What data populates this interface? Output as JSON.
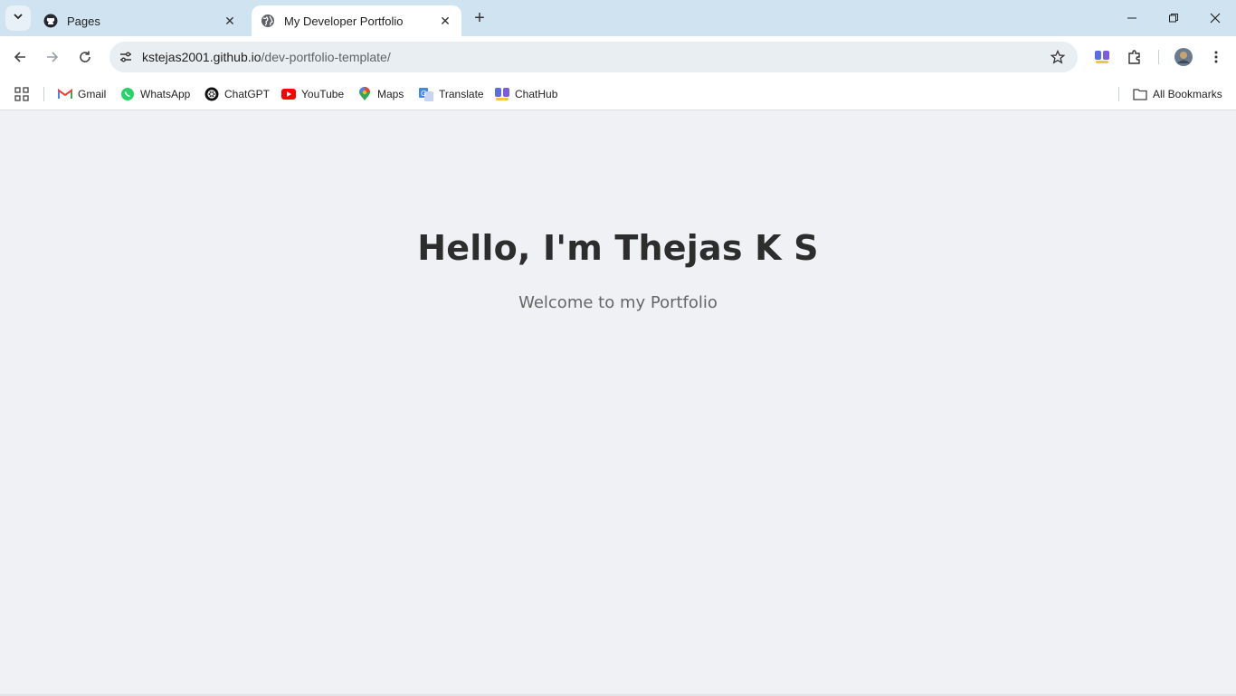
{
  "browser": {
    "tabs": [
      {
        "title": "Pages",
        "favicon": "github-icon",
        "active": false
      },
      {
        "title": "My Developer Portfolio",
        "favicon": "globe-icon",
        "active": true
      }
    ],
    "url_host": "kstejas2001.github.io",
    "url_path": "/dev-portfolio-template/"
  },
  "bookmarks": {
    "items": [
      {
        "label": "Gmail",
        "icon": "gmail-icon"
      },
      {
        "label": "WhatsApp",
        "icon": "whatsapp-icon"
      },
      {
        "label": "ChatGPT",
        "icon": "chatgpt-icon"
      },
      {
        "label": "YouTube",
        "icon": "youtube-icon"
      },
      {
        "label": "Maps",
        "icon": "maps-icon"
      },
      {
        "label": "Translate",
        "icon": "translate-icon"
      },
      {
        "label": "ChatHub",
        "icon": "chathub-icon"
      }
    ],
    "all_label": "All Bookmarks"
  },
  "page": {
    "title": "Hello, I'm Thejas K S",
    "subtitle": "Welcome to my Portfolio"
  },
  "colors": {
    "tabstrip": "#cfe3f0",
    "page_bg": "#f0f1f5",
    "title": "#2d2d2d",
    "subtitle": "#666666"
  }
}
